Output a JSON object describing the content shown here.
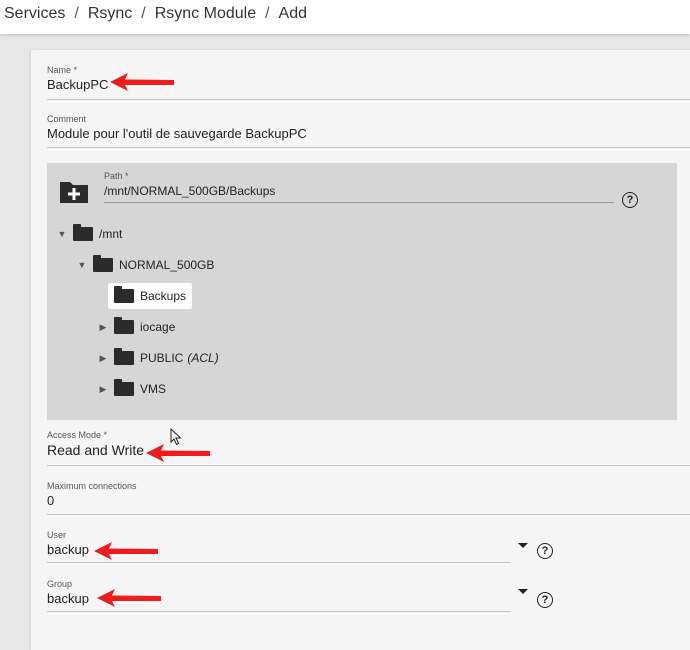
{
  "breadcrumb": [
    "Services",
    "Rsync",
    "Rsync Module",
    "Add"
  ],
  "form": {
    "name": {
      "label": "Name *",
      "value": "BackupPC"
    },
    "comment": {
      "label": "Comment",
      "value": "Module pour l'outil de sauvegarde BackupPC"
    },
    "path": {
      "label": "Path *",
      "value": "/mnt/NORMAL_500GB/Backups"
    },
    "tree": {
      "root": "/mnt",
      "child": "NORMAL_500GB",
      "items": [
        {
          "label": "Backups",
          "selected": true
        },
        {
          "label": "iocage"
        },
        {
          "label": "PUBLIC",
          "suffix": "(ACL)"
        },
        {
          "label": "VMS"
        }
      ]
    },
    "access_mode": {
      "label": "Access Mode *",
      "value": "Read and Write"
    },
    "max_connections": {
      "label": "Maximum connections",
      "value": "0"
    },
    "user": {
      "label": "User",
      "value": "backup"
    },
    "group": {
      "label": "Group",
      "value": "backup"
    }
  },
  "icons": {
    "help": "?",
    "folder_add": "folder-add-icon",
    "annotation_color": "#ee1c1c"
  }
}
